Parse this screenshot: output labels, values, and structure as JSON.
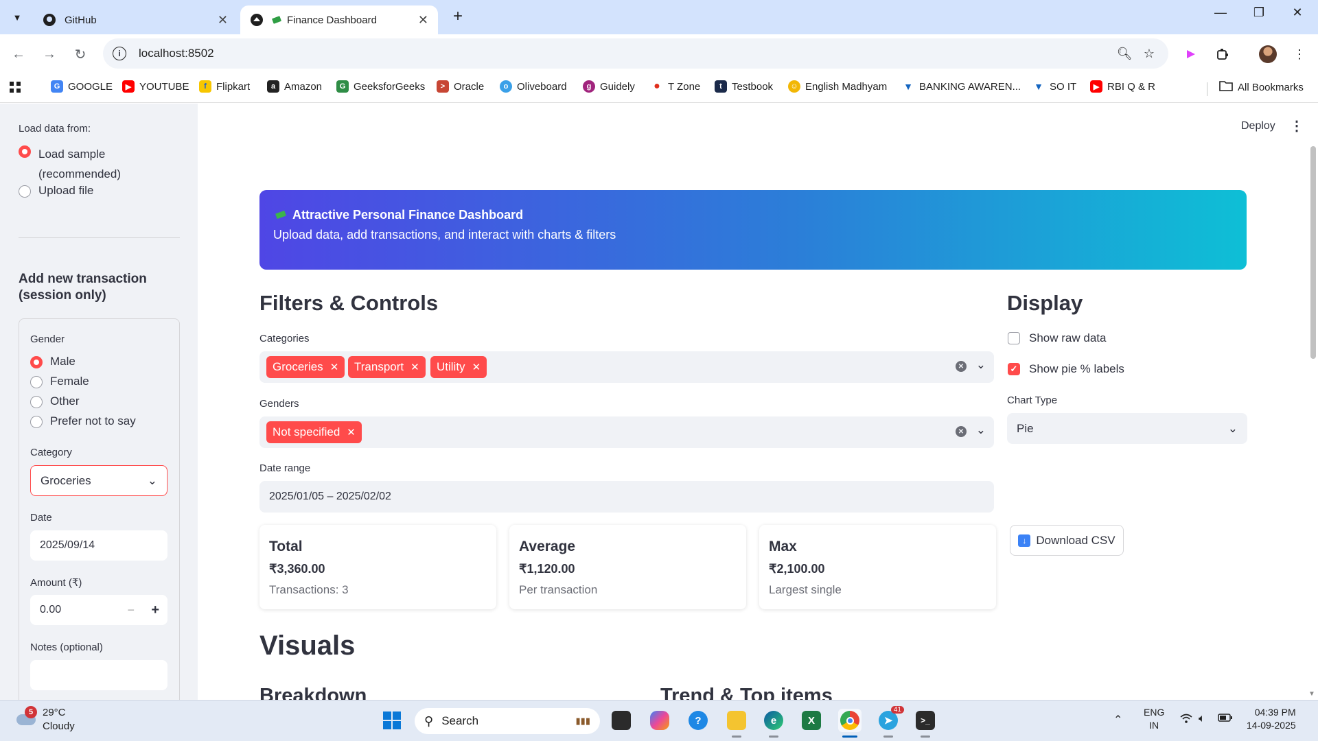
{
  "browser": {
    "tabs": [
      {
        "title": "GitHub",
        "active": false
      },
      {
        "title": "Finance Dashboard",
        "active": true
      }
    ],
    "url": "localhost:8502",
    "bookmarks": [
      {
        "label": "GOOGLE",
        "icon": "google-icon",
        "color": "#4285f4"
      },
      {
        "label": "YOUTUBE",
        "icon": "youtube-icon",
        "color": "#ff0000"
      },
      {
        "label": "Flipkart",
        "icon": "flipkart-icon",
        "color": "#f7c600"
      },
      {
        "label": "Amazon",
        "icon": "amazon-icon",
        "color": "#222222"
      },
      {
        "label": "GeeksforGeeks",
        "icon": "geeksforgeeks-icon",
        "color": "#2f8d46"
      },
      {
        "label": "Oracle",
        "icon": "oracle-icon",
        "color": "#c74634"
      },
      {
        "label": "Oliveboard",
        "icon": "oliveboard-icon",
        "color": "#3aa0e8"
      },
      {
        "label": "Guidely",
        "icon": "guidely-icon",
        "color": "#a1247d"
      },
      {
        "label": "T Zone",
        "icon": "tzone-icon",
        "color": "#e0301e"
      },
      {
        "label": "Testbook",
        "icon": "testbook-icon",
        "color": "#1b2a4a"
      },
      {
        "label": "English Madhyam",
        "icon": "english-madhyam-icon",
        "color": "#f2b705"
      },
      {
        "label": "BANKING AWAREN...",
        "icon": "banking-icon",
        "color": "#1565c0"
      },
      {
        "label": "SO IT",
        "icon": "so-it-icon",
        "color": "#1565c0"
      },
      {
        "label": "RBI Q & R",
        "icon": "youtube-icon",
        "color": "#ff0000"
      }
    ],
    "all_bookmarks": "All Bookmarks"
  },
  "sidebar": {
    "load_label": "Load data from:",
    "load_options": [
      {
        "label": "Load sample (recommended)",
        "selected": true
      },
      {
        "label": "Upload file",
        "selected": false
      }
    ],
    "add_heading": "Add new transaction (session only)",
    "gender_label": "Gender",
    "gender_options": [
      {
        "label": "Male",
        "selected": true
      },
      {
        "label": "Female",
        "selected": false
      },
      {
        "label": "Other",
        "selected": false
      },
      {
        "label": "Prefer not to say",
        "selected": false
      }
    ],
    "category_label": "Category",
    "category_value": "Groceries",
    "date_label": "Date",
    "date_value": "2025/09/14",
    "amount_label": "Amount (₹)",
    "amount_value": "0.00",
    "notes_label": "Notes (optional)",
    "notes_value": ""
  },
  "header": {
    "deploy": "Deploy"
  },
  "hero": {
    "title": "Attractive Personal Finance Dashboard",
    "subtitle": "Upload data, add transactions, and interact with charts & filters"
  },
  "filters": {
    "heading": "Filters & Controls",
    "categories_label": "Categories",
    "categories": [
      "Groceries",
      "Transport",
      "Utility"
    ],
    "genders_label": "Genders",
    "genders": [
      "Not specified"
    ],
    "date_range_label": "Date range",
    "date_range": "2025/01/05 – 2025/02/02"
  },
  "display": {
    "heading": "Display",
    "show_raw_data": {
      "label": "Show raw data",
      "checked": false
    },
    "show_pie_labels": {
      "label": "Show pie % labels",
      "checked": true
    },
    "chart_type_label": "Chart Type",
    "chart_type": "Pie"
  },
  "metrics": [
    {
      "title": "Total",
      "value": "₹3,360.00",
      "sub": "Transactions: 3"
    },
    {
      "title": "Average",
      "value": "₹1,120.00",
      "sub": "Per transaction"
    },
    {
      "title": "Max",
      "value": "₹2,100.00",
      "sub": "Largest single"
    }
  ],
  "download_label": "Download CSV",
  "visuals": {
    "heading": "Visuals",
    "breakdown": "Breakdown",
    "trend": "Trend & Top items"
  },
  "taskbar": {
    "temperature": "29°C",
    "condition": "Cloudy",
    "weather_badge": "5",
    "search_placeholder": "Search",
    "telegram_badge": "41",
    "lang_top": "ENG",
    "lang_bottom": "IN",
    "time": "04:39 PM",
    "date": "14-09-2025"
  },
  "colors": {
    "accent": "#ff4b4b",
    "hero_start": "#4f46e5",
    "hero_end": "#0ebfd6"
  }
}
